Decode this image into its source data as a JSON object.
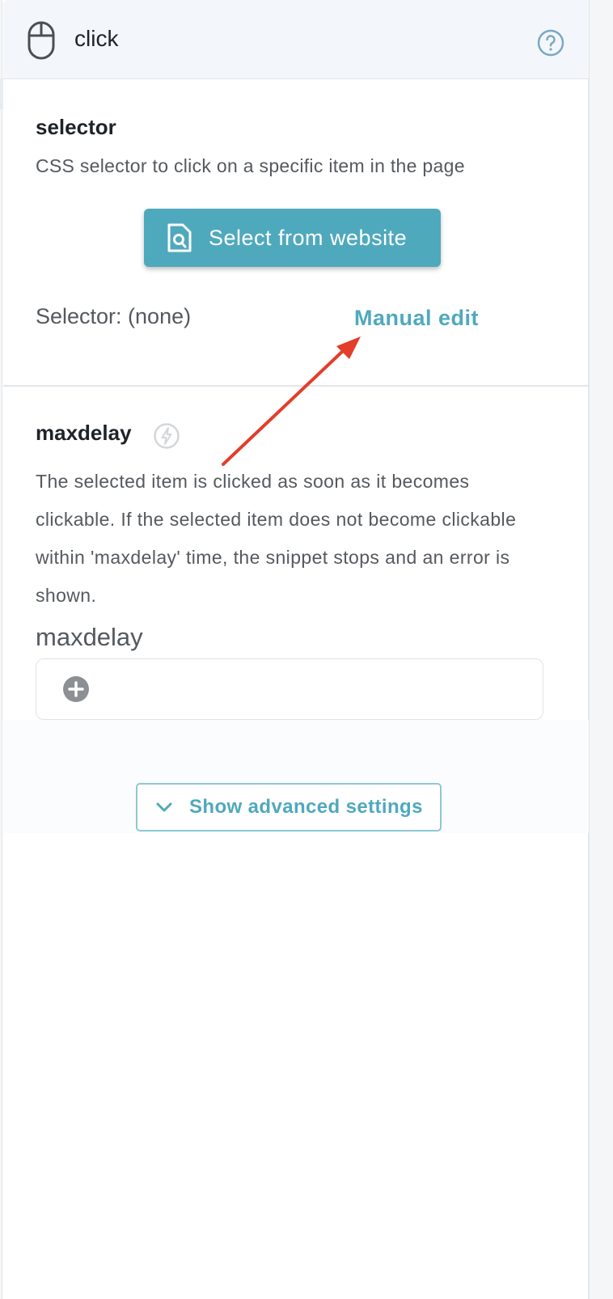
{
  "header": {
    "title": "click",
    "icon": "mouse-icon",
    "help_icon": "help-circle-icon"
  },
  "selector_section": {
    "title": "selector",
    "description": "CSS selector to click on a specific item in the page",
    "select_button_label": "Select from website",
    "select_button_icon": "document-search-icon",
    "selector_value": "Selector: (none)",
    "manual_edit_label": "Manual edit"
  },
  "maxdelay_section": {
    "title": "maxdelay",
    "dynamic_icon": "bolt-icon",
    "description": "The selected item is clicked as soon as it becomes clickable. If the selected item does not become clickable within 'maxdelay' time, the snippet stops and an error is shown.",
    "input_label": "maxdelay",
    "add_icon": "plus-circle-icon"
  },
  "advanced": {
    "label": "Show advanced settings",
    "icon": "chevron-down-icon"
  },
  "colors": {
    "accent": "#4fa9bc",
    "header_bg": "#f3f7fb",
    "annotation": "#e23e2a"
  }
}
